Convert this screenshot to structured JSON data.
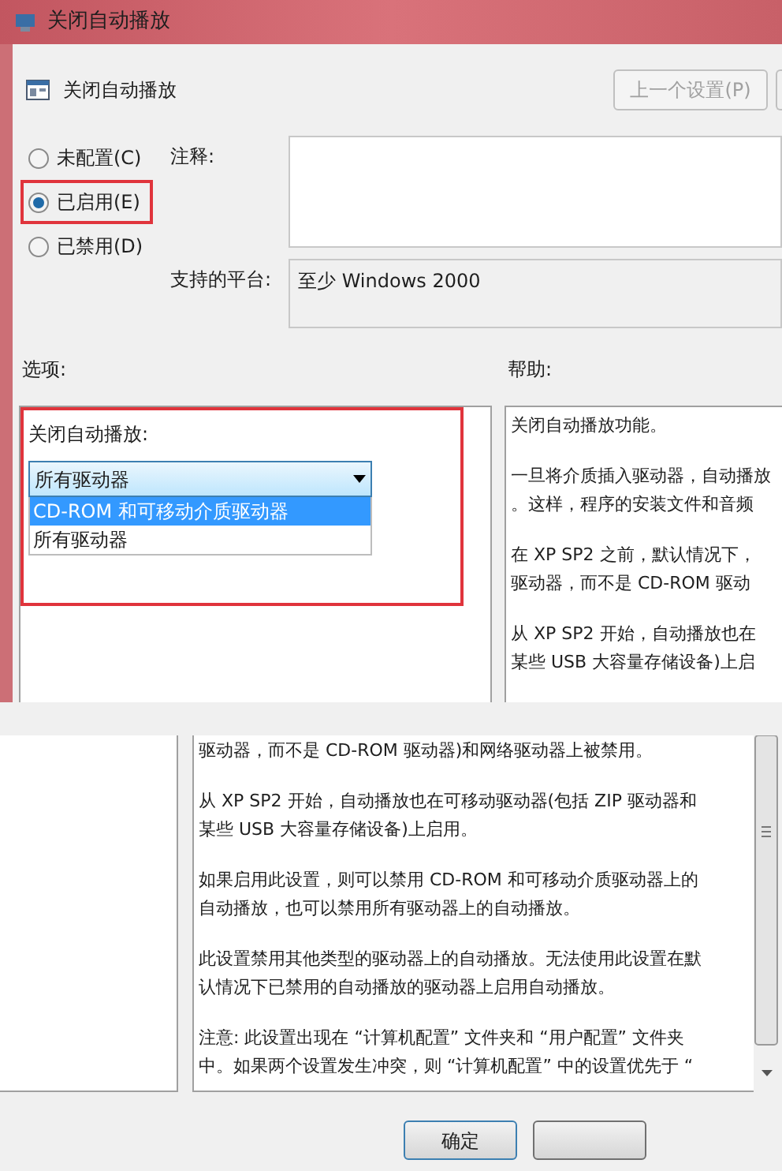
{
  "window": {
    "title": "关闭自动播放"
  },
  "header": {
    "title": "关闭自动播放",
    "prev_button": {
      "label": "上一个设置(P)",
      "disabled": true
    }
  },
  "state_options": [
    {
      "label": "未配置(C)",
      "selected": false,
      "highlighted": false
    },
    {
      "label": "已启用(E)",
      "selected": true,
      "highlighted": true
    },
    {
      "label": "已禁用(D)",
      "selected": false,
      "highlighted": false
    }
  ],
  "comment": {
    "label": "注释:"
  },
  "platform": {
    "label": "支持的平台:",
    "value": "至少 Windows 2000"
  },
  "options": {
    "label": "选项:",
    "highlighted": true,
    "setting_label": "关闭自动播放:",
    "dropdown": {
      "value": "所有驱动器",
      "expanded": true,
      "items": [
        {
          "label": "CD-ROM 和可移动介质驱动器",
          "highlighted": true
        },
        {
          "label": "所有驱动器",
          "highlighted": false
        }
      ]
    }
  },
  "help": {
    "label": "帮助:",
    "paragraphs": [
      [
        "关闭自动播放功能。"
      ],
      [
        "一旦将介质插入驱动器，自动播放",
        "。这样，程序的安装文件和音频"
      ],
      [
        "在 XP SP2 之前，默认情况下，",
        "驱动器，而不是 CD-ROM 驱动"
      ],
      [
        "从 XP SP2 开始，自动播放也在",
        "某些 USB 大容量存储设备)上启"
      ]
    ]
  },
  "help_continued": {
    "paragraphs": [
      [
        "驱动器，而不是 CD-ROM 驱动器)和网络驱动器上被禁用。"
      ],
      [
        "从 XP SP2 开始，自动播放也在可移动驱动器(包括 ZIP 驱动器和",
        "某些 USB 大容量存储设备)上启用。"
      ],
      [
        "如果启用此设置，则可以禁用 CD-ROM 和可移动介质驱动器上的",
        "自动播放，也可以禁用所有驱动器上的自动播放。"
      ],
      [
        "此设置禁用其他类型的驱动器上的自动播放。无法使用此设置在默",
        "认情况下已禁用的自动播放的驱动器上启用自动播放。"
      ],
      [
        "注意: 此设置出现在 “计算机配置” 文件夹和 “用户配置” 文件夹",
        "中。如果两个设置发生冲突，则 “计算机配置” 中的设置优先于 “"
      ]
    ]
  },
  "ok_button": {
    "label": "确定"
  }
}
